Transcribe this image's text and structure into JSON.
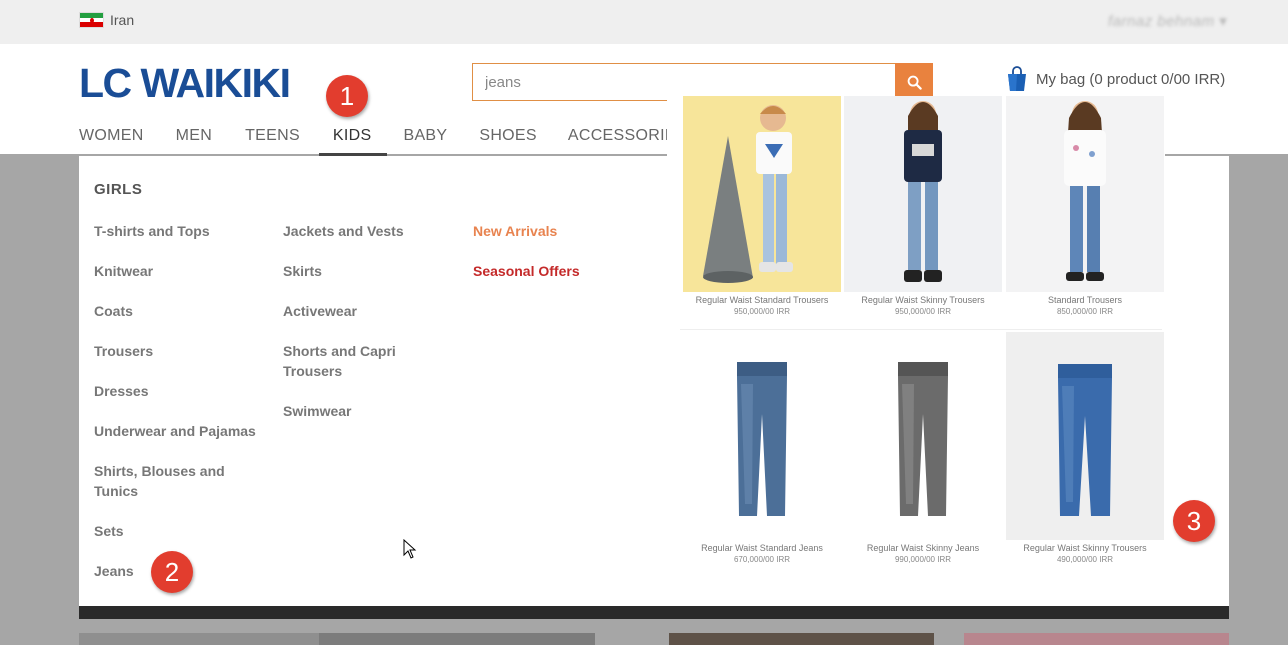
{
  "topbar": {
    "country": "Iran",
    "user_name": "farnaz behnam"
  },
  "header": {
    "logo_text": "LC WAIKIKI",
    "search": {
      "value": "jeans"
    },
    "bag_label": "My bag (0 product 0/00 IRR)"
  },
  "nav": [
    "WOMEN",
    "MEN",
    "TEENS",
    "KIDS",
    "BABY",
    "SHOES",
    "ACCESSORIES"
  ],
  "menu": {
    "title": "GIRLS",
    "col1": [
      "T-shirts and Tops",
      "Knitwear",
      "Coats",
      "Trousers",
      "Dresses",
      "Underwear and Pajamas",
      "Shirts, Blouses and Tunics",
      "Sets",
      "Jeans"
    ],
    "col2": [
      "Jackets and Vests",
      "Skirts",
      "Activewear",
      "Shorts and Capri Trousers",
      "Swimwear"
    ],
    "col3": [
      "New Arrivals",
      "Seasonal Offers"
    ]
  },
  "products": [
    {
      "name": "Regular Waist Standard Trousers",
      "price": "950,000/00 IRR"
    },
    {
      "name": "Regular Waist Skinny Trousers",
      "price": "950,000/00 IRR"
    },
    {
      "name": "Standard Trousers",
      "price": "850,000/00 IRR"
    },
    {
      "name": "Regular Waist Standard Jeans",
      "price": "670,000/00 IRR"
    },
    {
      "name": "Regular Waist Skinny Jeans",
      "price": "990,000/00 IRR"
    },
    {
      "name": "Regular Waist Skinny Trousers",
      "price": "490,000/00 IRR"
    }
  ],
  "badges": [
    "1",
    "2",
    "3"
  ],
  "colors": {
    "brand": "#1a4d96",
    "search_accent": "#e9823e",
    "badge": "#e23d2e",
    "new_arrivals": "#e8834f",
    "seasonal_offers": "#c42a2a"
  }
}
